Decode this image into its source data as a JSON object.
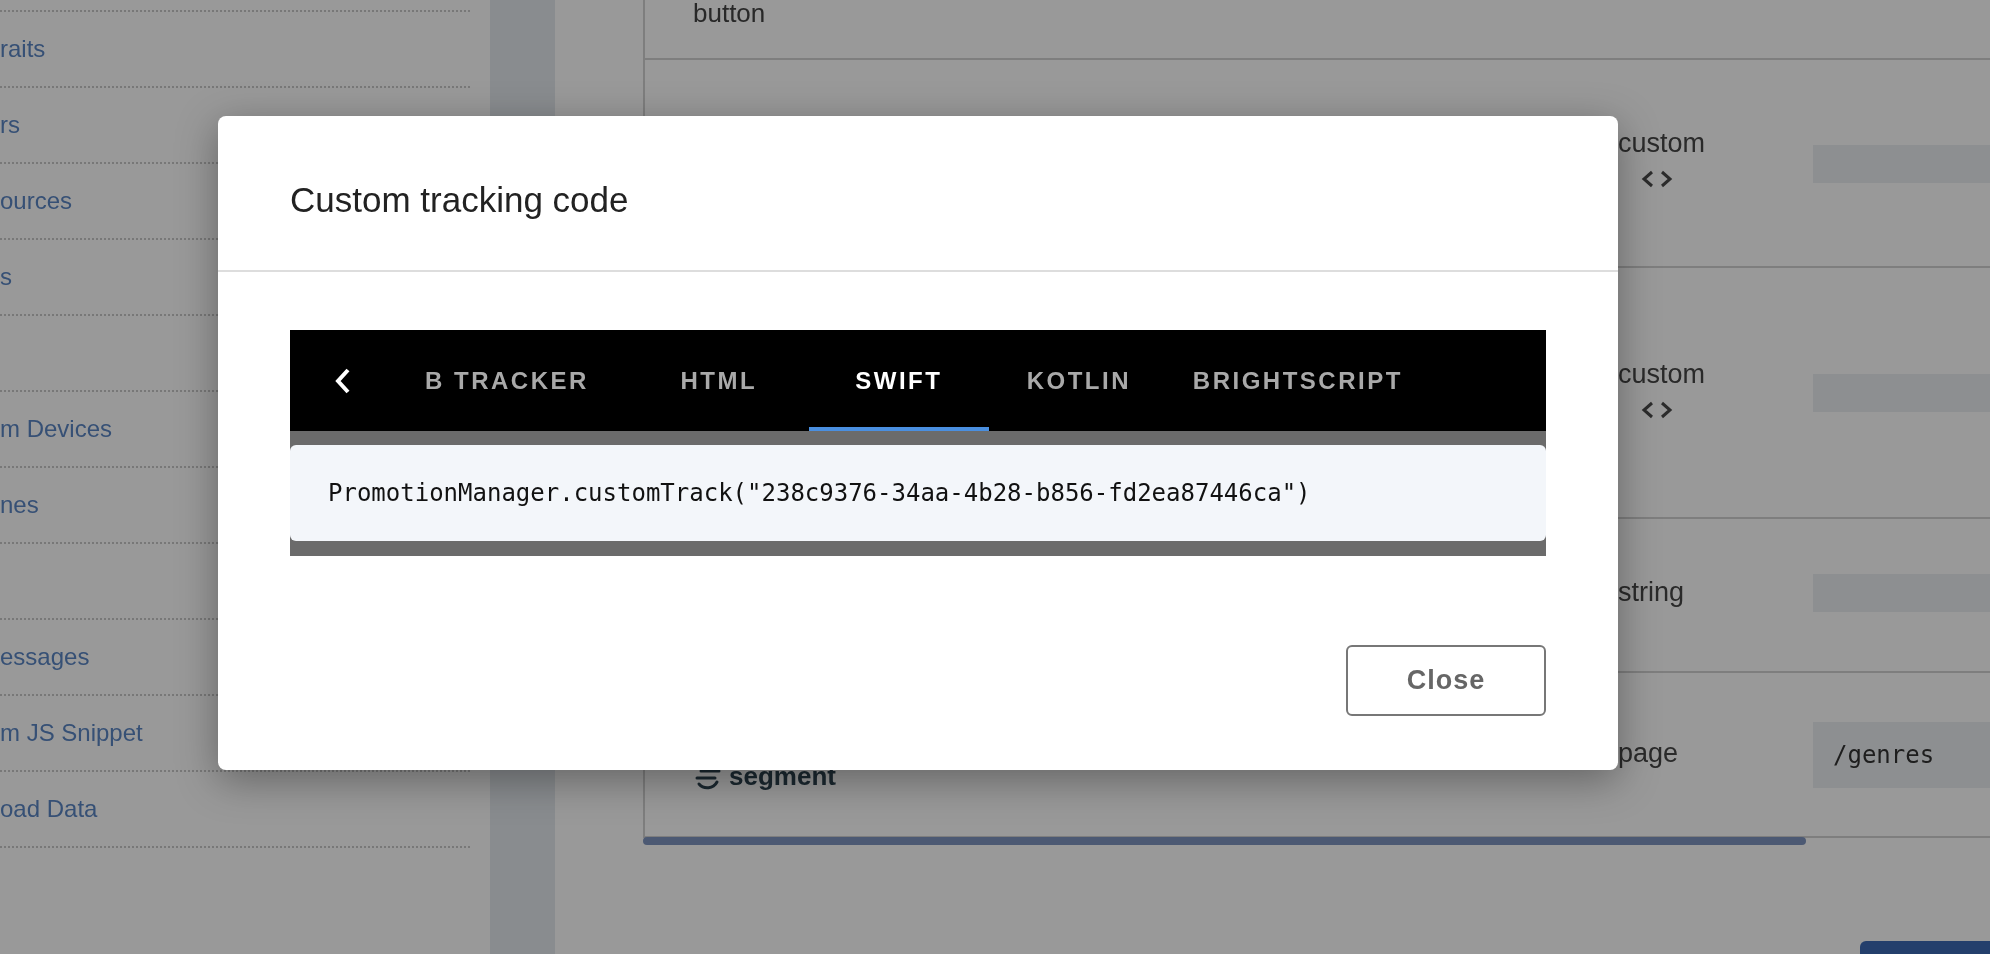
{
  "sidebar": {
    "sections": [
      {
        "items": [
          "raits",
          "rs",
          "ources",
          "s"
        ]
      },
      {
        "items": [
          "m Devices",
          "nes"
        ]
      },
      {
        "items": [
          "essages",
          "m JS Snippet",
          "oad Data"
        ]
      }
    ]
  },
  "table": {
    "rows": [
      {
        "kind": "plain",
        "label": "button"
      },
      {
        "kind": "code",
        "type": "custom"
      },
      {
        "kind": "code",
        "type": "custom"
      },
      {
        "kind": "plain",
        "type": "string"
      },
      {
        "kind": "logo",
        "logo": "segment",
        "type": "page",
        "value": "/genres"
      }
    ]
  },
  "dialog": {
    "title": "Custom tracking code",
    "tabs": [
      {
        "label": "B TRACKER",
        "selected": false
      },
      {
        "label": "HTML",
        "selected": false
      },
      {
        "label": "SWIFT",
        "selected": true
      },
      {
        "label": "KOTLIN",
        "selected": false
      },
      {
        "label": "BRIGHTSCRIPT",
        "selected": false
      }
    ],
    "code": "PromotionManager.customTrack(\"238c9376-34aa-4b28-b856-fd2ea87446ca\")",
    "close_button": "Close"
  }
}
